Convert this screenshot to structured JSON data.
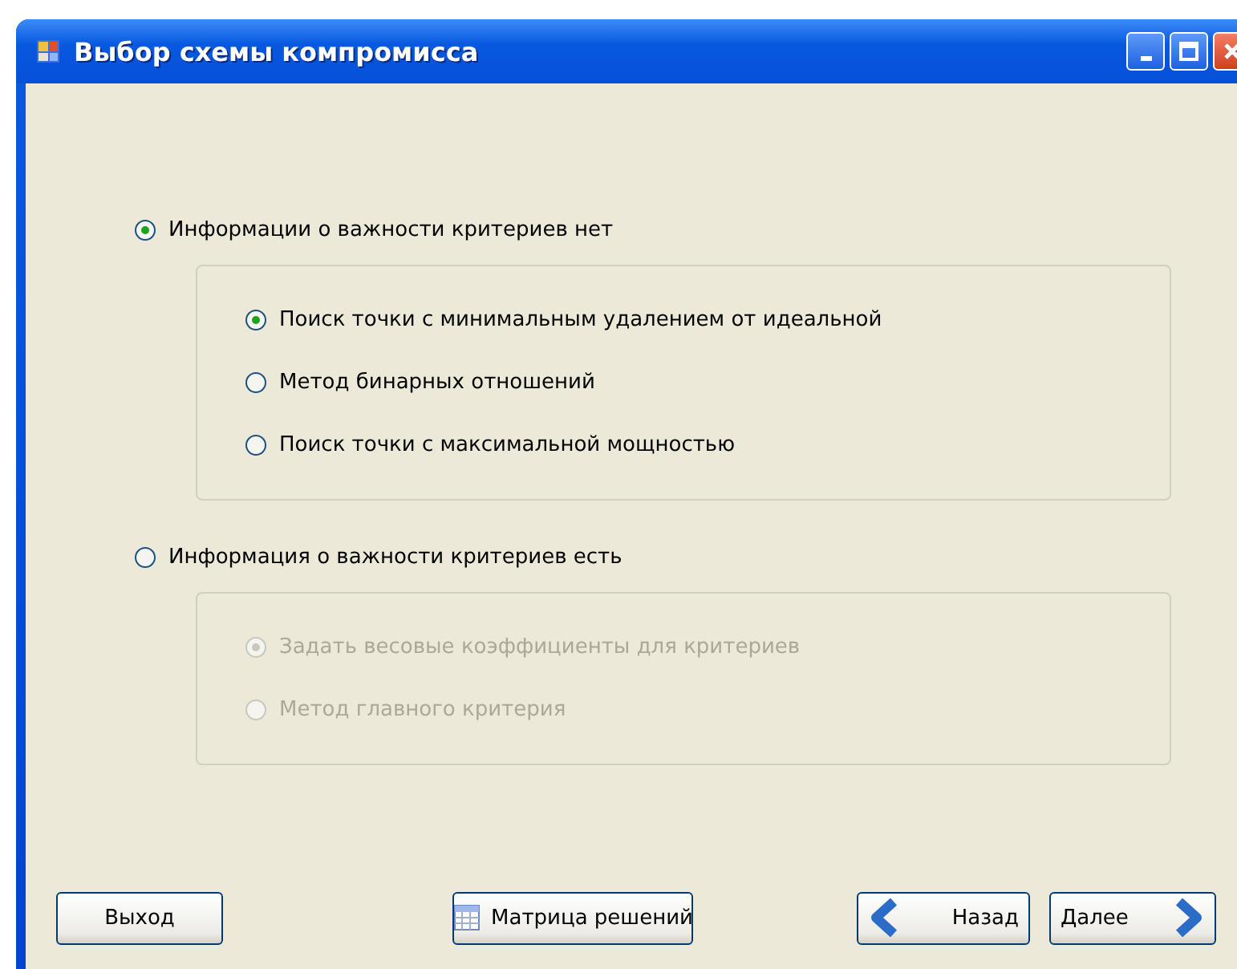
{
  "window": {
    "title": "Выбор схемы компромисса"
  },
  "groups": [
    {
      "label": "Информации о важности критериев нет",
      "selected": true,
      "disabled": false,
      "options": [
        {
          "label": "Поиск точки с минимальным удалением от идеальной",
          "selected": true
        },
        {
          "label": "Метод бинарных отношений",
          "selected": false
        },
        {
          "label": "Поиск точки с максимальной мощностью",
          "selected": false
        }
      ]
    },
    {
      "label": "Информация о важности критериев есть",
      "selected": false,
      "disabled": true,
      "options": [
        {
          "label": "Задать весовые коэффициенты для критериев",
          "selected": true
        },
        {
          "label": "Метод главного критерия",
          "selected": false
        }
      ]
    }
  ],
  "buttons": [
    {
      "label": "Выход",
      "kind": "plain"
    },
    {
      "label": "Матрица решений",
      "kind": "table"
    },
    {
      "label": "Назад",
      "kind": "back"
    },
    {
      "label": "Далее",
      "kind": "next"
    }
  ]
}
